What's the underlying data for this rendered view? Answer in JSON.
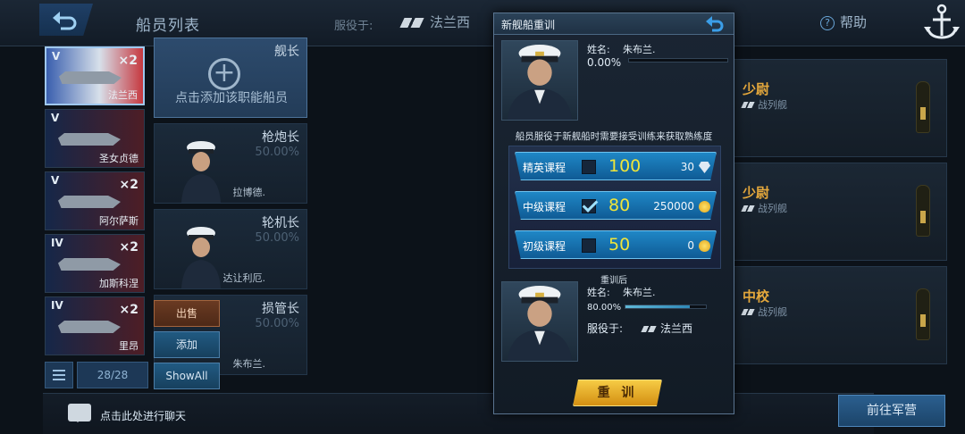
{
  "header": {
    "title": "船员列表",
    "service_label": "服役于:",
    "nation": "法兰西",
    "help": "帮助"
  },
  "ships": [
    {
      "tier": "V",
      "mult": "×2",
      "name": "法兰西",
      "selected": true
    },
    {
      "tier": "V",
      "mult": "",
      "name": "圣女贞德",
      "selected": false
    },
    {
      "tier": "V",
      "mult": "×2",
      "name": "阿尔萨斯",
      "selected": false
    },
    {
      "tier": "IV",
      "mult": "×2",
      "name": "加斯科涅",
      "selected": false
    },
    {
      "tier": "IV",
      "mult": "×2",
      "name": "里昂",
      "selected": false
    }
  ],
  "ship_counter": "28/28",
  "crew_slots": [
    {
      "role": "舰长",
      "add_text": "点击添加该职能船员"
    },
    {
      "role": "枪炮长",
      "percent": "50.00%",
      "name": "拉博德."
    },
    {
      "role": "轮机长",
      "percent": "50.00%",
      "name": "达让利厄."
    },
    {
      "role": "损管长",
      "percent": "50.00%",
      "name": "朱布兰."
    }
  ],
  "side_buttons": {
    "sell": "出售",
    "add": "添加",
    "show_all": "ShowAll"
  },
  "chat": {
    "text": "点击此处进行聊天"
  },
  "ranks": [
    {
      "title": "少尉",
      "type": "战列舰"
    },
    {
      "title": "少尉",
      "type": "战列舰"
    },
    {
      "title": "中校",
      "type": "战列舰"
    }
  ],
  "camp_button": "前往军营",
  "modal": {
    "title": "新舰船重训",
    "name_label": "姓名:",
    "name": "朱布兰.",
    "current_percent": "0.00%",
    "current_progress": 0,
    "notice": "船员服役于新舰船时需要接受训练来获取熟练度",
    "courses": [
      {
        "name": "精英课程",
        "checked": false,
        "exp": "100",
        "cost": "30",
        "currency": "diamond"
      },
      {
        "name": "中级课程",
        "checked": true,
        "exp": "80",
        "cost": "250000",
        "currency": "coin"
      },
      {
        "name": "初级课程",
        "checked": false,
        "exp": "50",
        "cost": "0",
        "currency": "coin"
      }
    ],
    "after_label": "重训后",
    "after_name_label": "姓名:",
    "after_name": "朱布兰.",
    "after_percent": "80.00%",
    "after_progress": 0.8,
    "after_service_label": "服役于:",
    "after_nation": "法兰西",
    "train_button": "重 训"
  }
}
